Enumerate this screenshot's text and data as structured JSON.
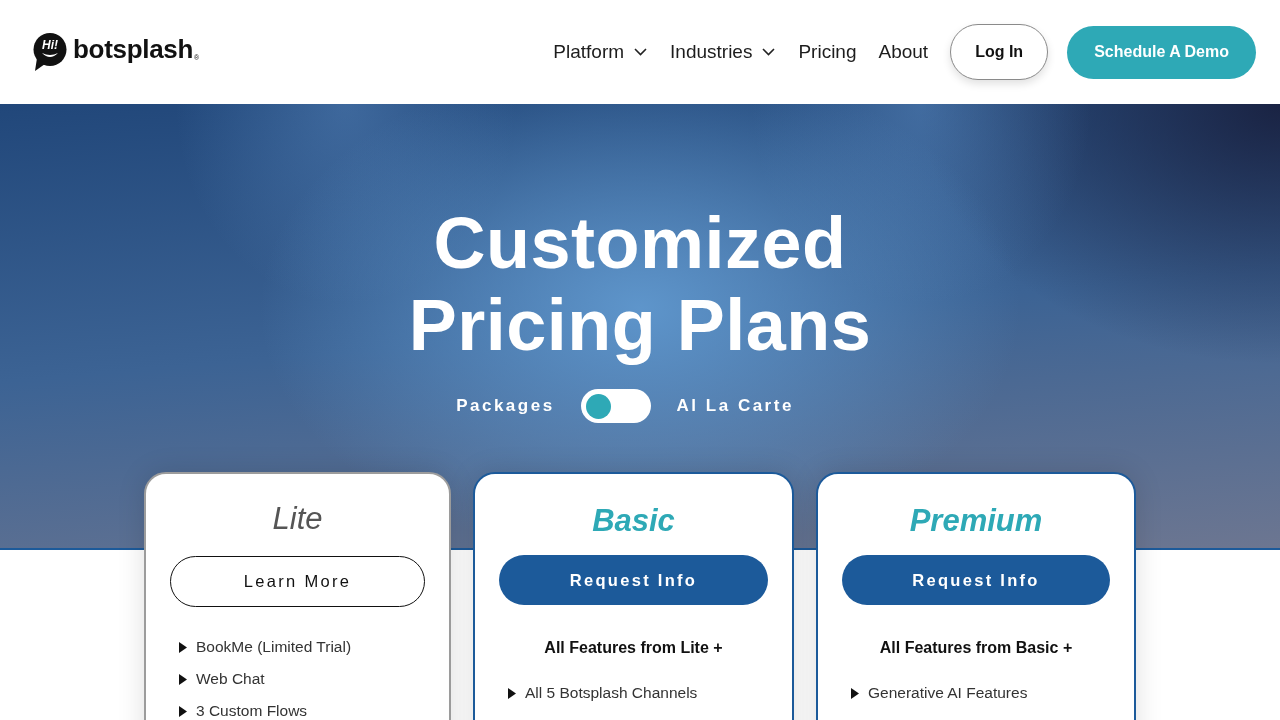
{
  "header": {
    "logo": {
      "badge_text": "Hi!",
      "wordmark": "botsplash",
      "registered_mark": "®"
    },
    "nav": [
      {
        "label": "Platform",
        "has_menu": true
      },
      {
        "label": "Industries",
        "has_menu": true
      },
      {
        "label": "Pricing",
        "has_menu": false
      },
      {
        "label": "About",
        "has_menu": false
      }
    ],
    "login_button": "Log In",
    "demo_button": "Schedule A Demo"
  },
  "hero": {
    "title": "Customized Pricing Plans",
    "plan_toggle": {
      "left_label": "Packages",
      "right_label": "Al La Carte",
      "on": false
    }
  },
  "plans": [
    {
      "name": "Lite",
      "highlighted": false,
      "button": "Learn More",
      "features": [
        "BookMe (Limited Trial)",
        "Web Chat",
        "3 Custom Flows"
      ]
    },
    {
      "name": "Basic",
      "highlighted": true,
      "button": "Request Info",
      "heading": "All Features from Lite +",
      "features": [
        "All 5 Botsplash Channels"
      ]
    },
    {
      "name": "Premium",
      "highlighted": true,
      "button": "Request Info",
      "heading": "All Features from Basic +",
      "features": [
        "Generative AI Features"
      ]
    }
  ]
}
